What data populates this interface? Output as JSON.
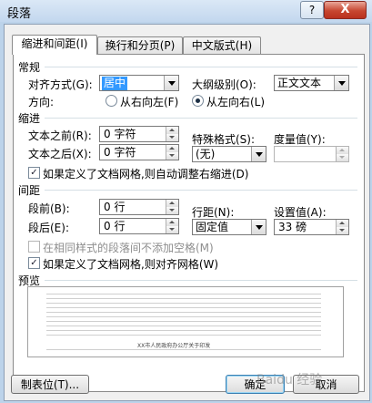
{
  "window": {
    "title": "段落",
    "help_label": "?",
    "close_label": "X"
  },
  "tabs": [
    {
      "label": "缩进和间距(I)",
      "active": true
    },
    {
      "label": "换行和分页(P)",
      "active": false
    },
    {
      "label": "中文版式(H)",
      "active": false
    }
  ],
  "general": {
    "section_label": "常规",
    "alignment_label": "对齐方式(G):",
    "alignment_value": "居中",
    "outline_label": "大纲级别(O):",
    "outline_value": "正文文本",
    "direction_label": "方向:",
    "rtl_label": "从右向左(F)",
    "ltr_label": "从左向右(L)"
  },
  "indent": {
    "section_label": "缩进",
    "before_label": "文本之前(R):",
    "before_value": "0 字符",
    "after_label": "文本之后(X):",
    "after_value": "0 字符",
    "special_label": "特殊格式(S):",
    "special_value": "(无)",
    "by_label": "度量值(Y):",
    "by_value": "",
    "auto_adjust_label": "如果定义了文档网格,则自动调整右缩进(D)"
  },
  "spacing": {
    "section_label": "间距",
    "before_label": "段前(B):",
    "before_value": "0 行",
    "after_label": "段后(E):",
    "after_value": "0 行",
    "line_label": "行距(N):",
    "line_value": "固定值",
    "at_label": "设置值(A):",
    "at_value": "33 磅",
    "no_space_label": "在相同样式的段落间不添加空格(M)",
    "snap_grid_label": "如果定义了文档网格,则对齐网格(W)"
  },
  "preview": {
    "section_label": "预览",
    "caption": "XX市人民政府办公厅关于印发"
  },
  "buttons": {
    "tabs_label": "制表位(T)...",
    "ok_label": "确定",
    "cancel_label": "取消"
  },
  "watermark": "Baidu 经验",
  "colors": {
    "accent": "#3399ff",
    "title_bar": "#c3d7ee",
    "close": "#c74630"
  }
}
